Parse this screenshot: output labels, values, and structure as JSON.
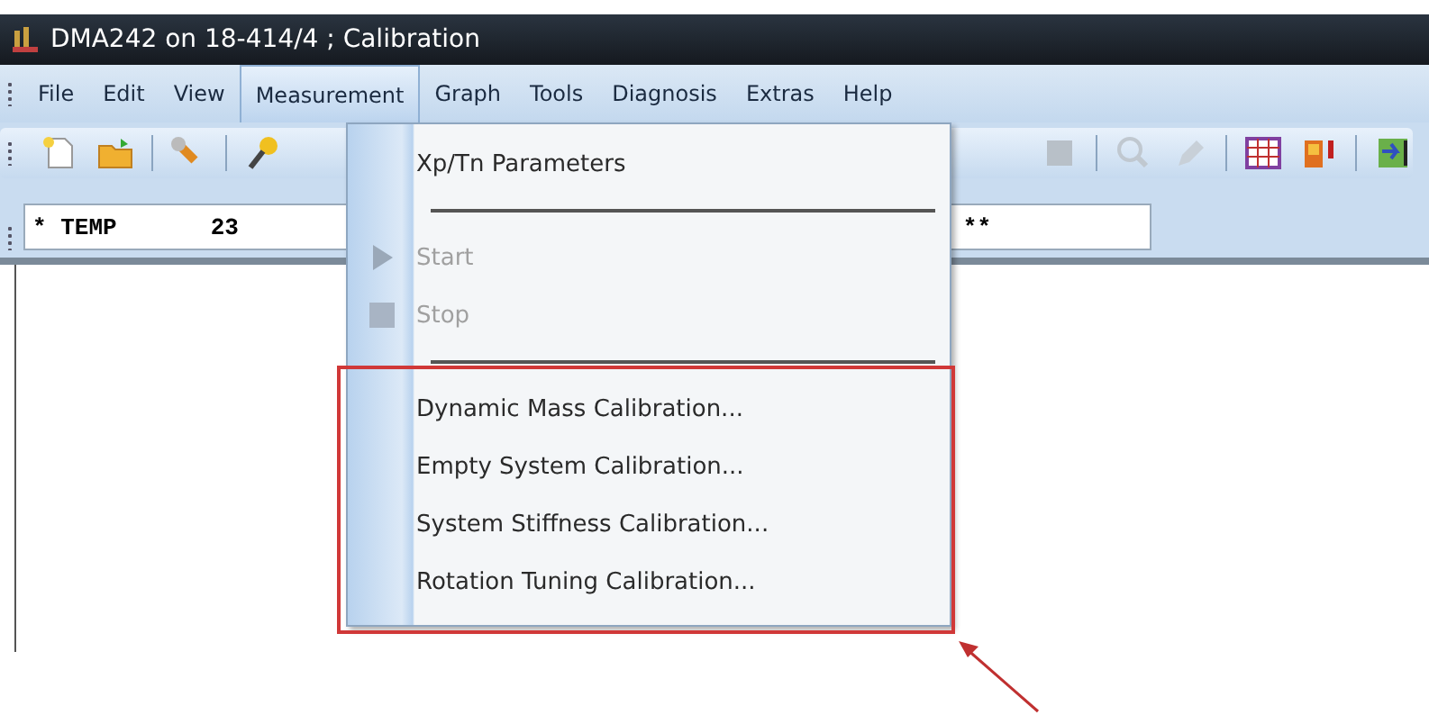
{
  "window": {
    "title": "DMA242 on 18-414/4 ; Calibration"
  },
  "menu_bar": [
    {
      "label": "File",
      "selected": false
    },
    {
      "label": "Edit",
      "selected": false
    },
    {
      "label": "View",
      "selected": false
    },
    {
      "label": "Measurement",
      "selected": true
    },
    {
      "label": "Graph",
      "selected": false
    },
    {
      "label": "Tools",
      "selected": false
    },
    {
      "label": "Diagnosis",
      "selected": false
    },
    {
      "label": "Extras",
      "selected": false
    },
    {
      "label": "Help",
      "selected": false
    }
  ],
  "status_field": {
    "label": "* TEMP",
    "value": "23",
    "trailing": "**"
  },
  "menu": {
    "items": [
      {
        "kind": "item",
        "label": "Xp/Tn Parameters",
        "disabled": false
      },
      {
        "kind": "separator"
      },
      {
        "kind": "start",
        "label": "Start",
        "disabled": true
      },
      {
        "kind": "stop",
        "label": "Stop",
        "disabled": true
      },
      {
        "kind": "separator"
      },
      {
        "kind": "item",
        "label": "Dynamic Mass Calibration...",
        "disabled": false
      },
      {
        "kind": "item",
        "label": "Empty System Calibration...",
        "disabled": false
      },
      {
        "kind": "item",
        "label": "System Stiffness Calibration...",
        "disabled": false
      },
      {
        "kind": "item",
        "label": "Rotation Tuning Calibration...",
        "disabled": false
      }
    ]
  }
}
